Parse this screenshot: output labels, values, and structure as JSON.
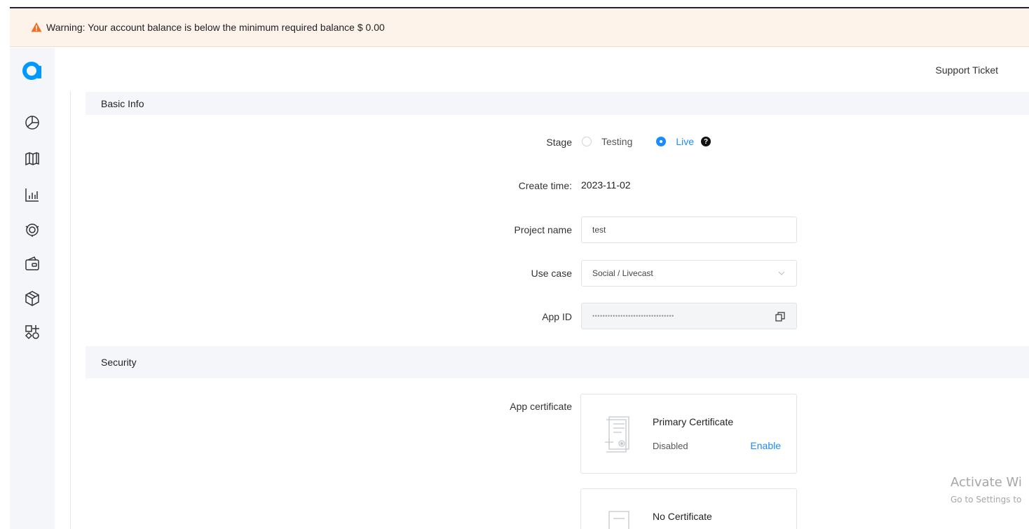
{
  "warning": {
    "text": "Warning: Your account balance is below the minimum required balance $ 0.00",
    "color": "#f36d21"
  },
  "header": {
    "support_ticket": "Support Ticket"
  },
  "sidebar": {
    "items": [
      {
        "icon": "pie-chart-icon"
      },
      {
        "icon": "map-icon"
      },
      {
        "icon": "bar-chart-icon"
      },
      {
        "icon": "support-icon"
      },
      {
        "icon": "wallet-icon"
      },
      {
        "icon": "cube-icon"
      },
      {
        "icon": "add-extension-icon"
      }
    ]
  },
  "basic_info": {
    "title": "Basic Info",
    "stage_label": "Stage",
    "stage_options": [
      "Testing",
      "Live"
    ],
    "stage_selected": "Live",
    "create_time_label": "Create time:",
    "create_time_value": "2023-11-02",
    "project_name_label": "Project name",
    "project_name_value": "test",
    "use_case_label": "Use case",
    "use_case_value": "Social / Livecast",
    "app_id_label": "App ID",
    "app_id_value": "••••••••••••••••••••••••••••••••"
  },
  "security": {
    "title": "Security",
    "app_certificate_label": "App certificate",
    "primary_certificate": {
      "title": "Primary Certificate",
      "status": "Disabled",
      "action": "Enable"
    },
    "secondary_certificate": {
      "title": "No Certificate"
    }
  },
  "watermark": {
    "title": "Activate Wi",
    "subtitle": "Go to Settings to"
  },
  "colors": {
    "accent": "#1a8cff",
    "brand": "#0099ff",
    "warning_bg": "#fdf3ea"
  }
}
